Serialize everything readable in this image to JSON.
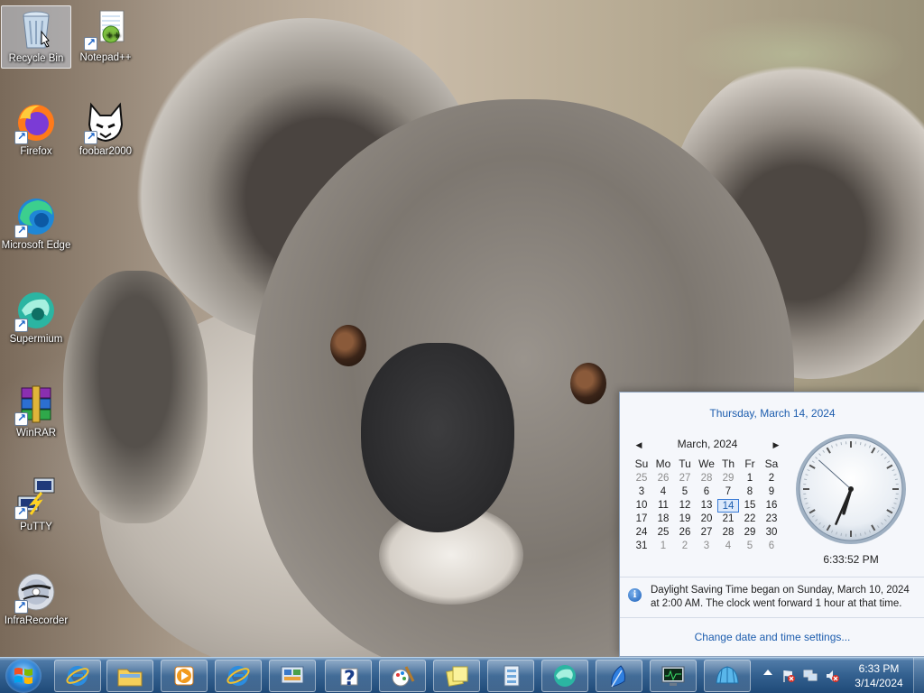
{
  "desktop": {
    "icons": [
      {
        "label": "Recycle Bin",
        "icon": "recycle-bin-icon"
      },
      {
        "label": "Notepad++",
        "icon": "notepad-plus-plus-icon"
      },
      {
        "label": "Firefox",
        "icon": "firefox-icon"
      },
      {
        "label": "foobar2000",
        "icon": "foobar2000-icon"
      },
      {
        "label": "Microsoft Edge",
        "icon": "edge-icon"
      },
      {
        "label": "Supermium",
        "icon": "supermium-icon"
      },
      {
        "label": "WinRAR",
        "icon": "winrar-icon"
      },
      {
        "label": "PuTTY",
        "icon": "putty-icon"
      },
      {
        "label": "InfraRecorder",
        "icon": "infrarecorder-icon"
      }
    ]
  },
  "flyout": {
    "long_date": "Thursday, March 14, 2024",
    "month_label": "March, 2024",
    "weekdays": [
      "Su",
      "Mo",
      "Tu",
      "We",
      "Th",
      "Fr",
      "Sa"
    ],
    "days": [
      "25",
      "26",
      "27",
      "28",
      "29",
      "1",
      "2",
      "3",
      "4",
      "5",
      "6",
      "7",
      "8",
      "9",
      "10",
      "11",
      "12",
      "13",
      "14",
      "15",
      "16",
      "17",
      "18",
      "19",
      "20",
      "21",
      "22",
      "23",
      "24",
      "25",
      "26",
      "27",
      "28",
      "29",
      "30",
      "31",
      "1",
      "2",
      "3",
      "4",
      "5",
      "6"
    ],
    "selected_day": "14",
    "time": "6:33:52 PM",
    "clock": {
      "hour": 6,
      "minute": 33,
      "second": 52
    },
    "dst_note": "Daylight Saving Time began on Sunday, March 10, 2024 at 2:00 AM. The clock went forward 1 hour at that time.",
    "settings_link": "Change date and time settings..."
  },
  "taskbar": {
    "start_icon": "windows-start-icon",
    "pinned": [
      "internet-explorer-icon",
      "file-explorer-icon",
      "media-player-icon",
      "internet-explorer-icon",
      "control-panel-icon",
      "help-icon",
      "paint-icon",
      "sticky-notes-icon",
      "document-viewer-icon",
      "supermium-icon",
      "feather-icon",
      "system-monitor-icon",
      "shell-icon"
    ],
    "tray": {
      "icons": [
        "show-hidden-icons-arrow",
        "action-center-flag-icon",
        "network-icon",
        "volume-muted-icon"
      ],
      "clock_time": "6:33 PM",
      "clock_date": "3/14/2024"
    }
  },
  "colors": {
    "link": "#1d5dae",
    "taskbar": "#33608f",
    "flyout_bg": "#f5f7fb"
  }
}
